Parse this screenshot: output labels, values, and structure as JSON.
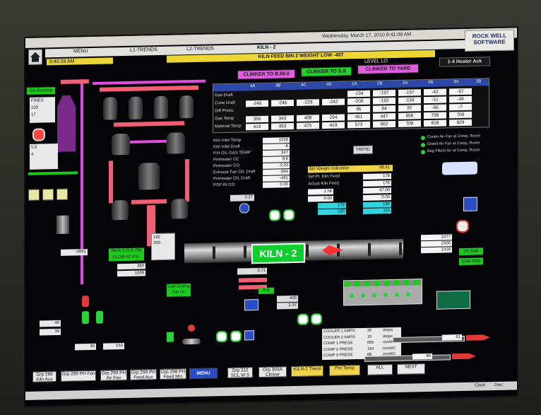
{
  "header": {
    "timestamp": "Wednesday, March 17, 2010   8:41:08 AM",
    "logo_line1": "ROCK WELL",
    "logo_line2": "SOFTWARE",
    "menu_label": "MENU",
    "l1_trends": "L1-TRENDS",
    "l2_trends": "L2-TRENDS",
    "screen_title": "KILN - 2",
    "time_display": "8:40:28 AM",
    "alarm_text": "KILN FEED BIN 2 WEIGHT LOW -48T",
    "level_lo": "LEVEL LO",
    "heater_ack": "1-4 Heater Ack"
  },
  "routing": {
    "clinker_b58": "CLINKER TO B.58.0",
    "clinker_ss": "CLINKER TO S.S",
    "clinker_yard": "CLINKER TO YARD"
  },
  "preheater_table": {
    "columns": [
      "4A",
      "4B",
      "4C",
      "4D",
      "1A",
      "1B",
      "2A",
      "2B",
      "3A",
      "3B"
    ],
    "rows": [
      {
        "label": "Gas Draft",
        "values": [
          "",
          "",
          "",
          "",
          "-134",
          "-197",
          "-197",
          "-42",
          "-57",
          ""
        ]
      },
      {
        "label": "Cone Draft",
        "values": [
          "-246",
          "-246",
          "-229",
          "-242",
          "-200",
          "-192",
          "-159",
          "-51",
          "-49",
          ""
        ]
      },
      {
        "label": "Diff Press.",
        "values": [
          "",
          "",
          "",
          "",
          "85",
          "84",
          "97",
          "-66",
          "-7",
          ""
        ]
      },
      {
        "label": "Gas Temp",
        "values": [
          "356",
          "343",
          "408",
          "294",
          "451",
          "447",
          "658",
          "738",
          "700",
          ""
        ]
      },
      {
        "label": "Material Temp",
        "values": [
          "419",
          "453",
          "475",
          "419",
          "573",
          "562",
          "708",
          "818",
          "829",
          ""
        ]
      }
    ]
  },
  "kiln_params": {
    "inlet_temp_label": "Kiln Inlet Temp",
    "inlet_temp_value": "1028",
    "inlet_draft_label": "Kiln Inlet Draft",
    "inlet_draft_value": "-8",
    "ph_gas_temp_label": "P.H O/L GAS TEMP",
    "ph_gas_temp_value": "347",
    "preheater_o2_label": "Preheater O2",
    "preheater_o2_value": "9.6",
    "preheater_co_label": "Preheater CO",
    "preheater_co_value": "0.20",
    "exhaust_draft_label": "Exhaust Fan O/L Draft",
    "exhaust_draft_value": "-394",
    "preheater_ol_label": "Preheater O/L Draft",
    "preheater_ol_value": "-461",
    "psp_co_label": "PSP IN CO",
    "psp_co_value": "0.00",
    "trend_button": "TREND"
  },
  "bin_weight": {
    "title": "Bin Weight Indication",
    "value": "48.41",
    "set_feed_label": "Set Pt. Kiln Feed",
    "set_feed_value": "178",
    "actual_feed_label": "Actual Kiln Feed",
    "actual_feed_value": "176",
    "r1": "1.58",
    "r2": "0.00",
    "r3": "47.00",
    "r4": "0.00",
    "cyan1": "178",
    "cyan2": "190",
    "cyan3": "180",
    "cyan4": "115"
  },
  "right_status": {
    "line1": "Cooler Air Fan at Comp. Room",
    "line2": "Grand Air Fan at Comp. Room",
    "line3": "Bag Filters Air at Comp. Room"
  },
  "kiln": {
    "label": "KILN - 2",
    "speed": "3.71"
  },
  "left_panel": {
    "gb_running": "GB Running",
    "fines_label": "FINES",
    "stop_label": "STOP",
    "coal_values": [
      "103",
      "17",
      "5.0",
      "-4061",
      "4"
    ],
    "r_values": [
      "192",
      "350",
      "380",
      "1009"
    ],
    "bin_a": "40",
    "bin_b": "39",
    "bin_c": "30",
    "bin_d": "153",
    "green1": "PA R.S.O.P. ON",
    "green2": "FLOW AT P.H.",
    "gcool": "Coal Cooling Fan On"
  },
  "cooler": {
    "amps_labels": [
      "COOLER 1 AMPS",
      "COOLER 2 AMPS",
      "COMP 1 PRESS",
      "COMP 2 PRESS",
      "COMP 3 PRESS"
    ],
    "amps_values": [
      "25",
      "15",
      "656",
      "154",
      "68"
    ],
    "unit": "Amps",
    "press_unit": "mmWC",
    "values_right": [
      "2477",
      "2300",
      "1416"
    ],
    "conveyor_a": "61",
    "conveyor_b": "90",
    "oil_sold": "Oil Sold",
    "coal_sold": "Coal Sold"
  },
  "mid_small": {
    "speed": "3.27",
    "pressure_a": "400",
    "pressure_b": "2.37",
    "exit_label": "Exit Cont",
    "rpm1": "87.0",
    "rpm2": "9.8",
    "r1": "4.3",
    "r2": "61.2",
    "r3": "76.7"
  },
  "bottom_buttons": [
    {
      "label": "Grp 288 Kiln Aux",
      "color": "#e8e8e8"
    },
    {
      "label": "Grp 289 PH Fan",
      "color": "#e8e8e8"
    },
    {
      "label": "Grp 290 PH Air Fan",
      "color": "#e8e8e8"
    },
    {
      "label": "Grp 299 PH Feed Aux",
      "color": "#e8e8e8"
    },
    {
      "label": "Grp 298 PH Feed M/c",
      "color": "#e8e8e8"
    },
    {
      "label": "MENU",
      "color": "#2a4cc4"
    },
    {
      "label": "Grp 312 SCL W S Syt",
      "color": "#e8e8e8"
    },
    {
      "label": "Grp 303A Clinker Trans",
      "color": "#e8e8e8"
    },
    {
      "label": "KILN-2 Trend",
      "color": "#f0d34a"
    },
    {
      "label": "Pre Temp",
      "color": "#f0d34a"
    },
    {
      "label": "ALL",
      "color": "#e8e8e8"
    },
    {
      "label": "NEXT",
      "color": "#e8e8e8"
    }
  ],
  "taskbar": {
    "left_text": "",
    "right_a": "Clock",
    "right_b": "Dev.:"
  },
  "colors": {
    "screen_bg": "#050507",
    "pipe_red": "#f25f74",
    "pipe_magenta": "#e04be0",
    "kiln_green": "#0fcf2f",
    "alarm_yellow": "#ecd633"
  }
}
